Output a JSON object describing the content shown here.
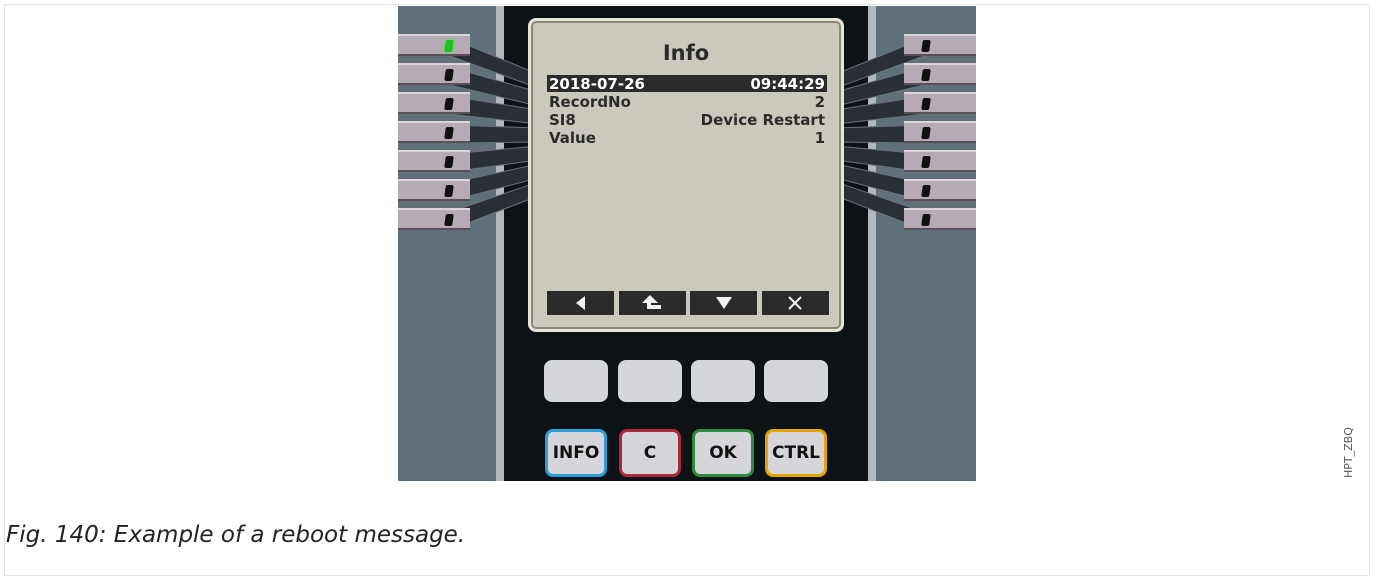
{
  "lcd": {
    "title": "Info",
    "rows": [
      {
        "label": "2018-07-26",
        "value": "09:44:29",
        "selected": true
      },
      {
        "label": "RecordNo",
        "value": "2"
      },
      {
        "label": "SI8",
        "value": "Device Restart"
      },
      {
        "label": "Value",
        "value": "1"
      }
    ]
  },
  "softkeys": [
    {
      "icon": "triangle-left-icon",
      "glyph": "◀"
    },
    {
      "icon": "arrow-up-turn-icon",
      "glyph": "⬑"
    },
    {
      "icon": "triangle-down-icon",
      "glyph": "▼"
    },
    {
      "icon": "close-icon",
      "glyph": "✕"
    }
  ],
  "buttons": {
    "info": {
      "label": "INFO",
      "color": "#2a9fd6"
    },
    "c": {
      "label": "C",
      "color": "#a8283c"
    },
    "ok": {
      "label": "OK",
      "color": "#2e8b3d"
    },
    "ctrl": {
      "label": "CTRL",
      "color": "#e6a400"
    }
  },
  "leds": {
    "left_green_index": 0
  },
  "caption": "Fig. 140: Example of a reboot message.",
  "side_tag": "HPT_ZBQ"
}
